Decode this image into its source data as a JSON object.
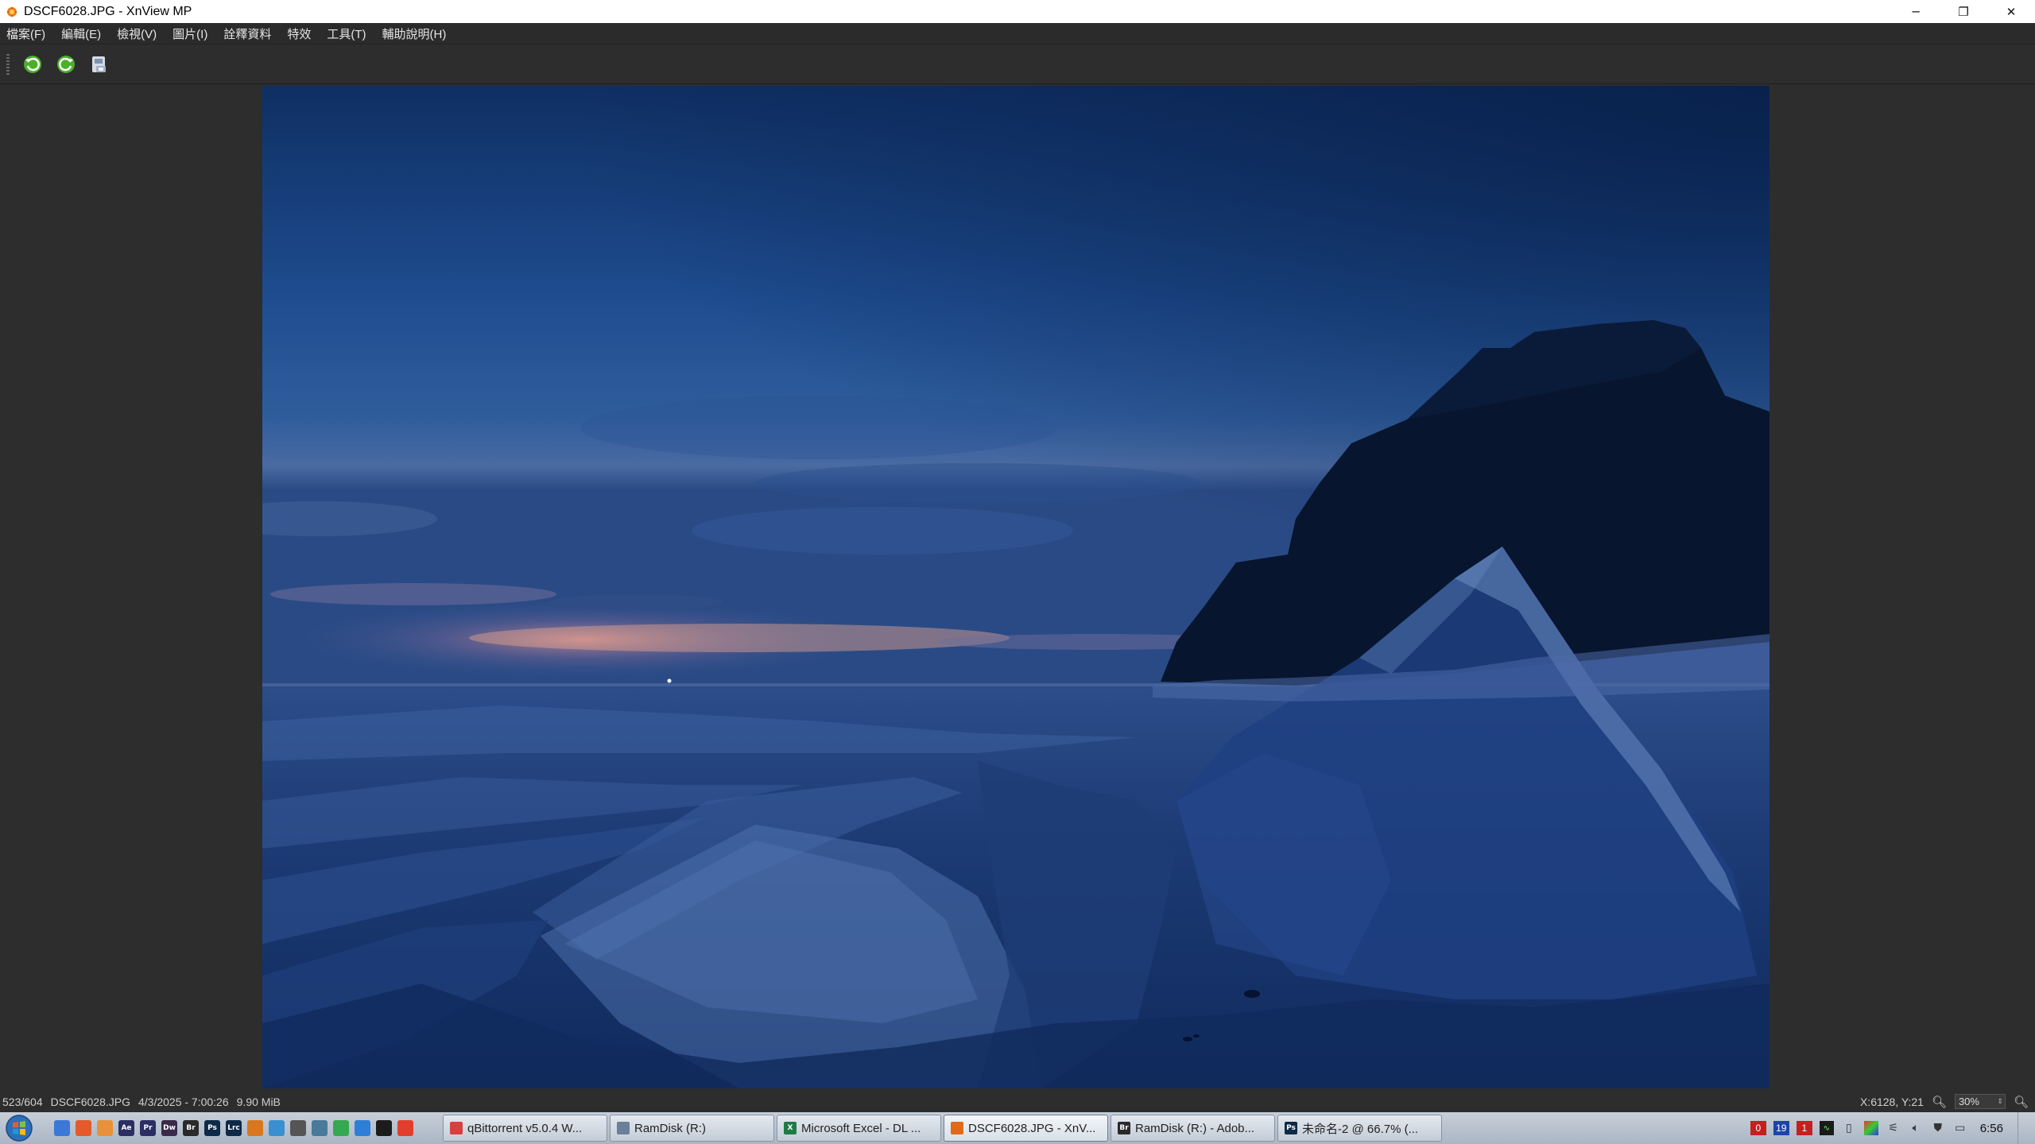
{
  "window": {
    "title": "DSCF6028.JPG - XnView MP",
    "minimize": "─",
    "restore": "❐",
    "close": "✕"
  },
  "menu": {
    "items": [
      "檔案(F)",
      "編輯(E)",
      "檢視(V)",
      "圖片(I)",
      "詮釋資料",
      "特效",
      "工具(T)",
      "輔助說明(H)"
    ]
  },
  "toolbar": {
    "buttons": [
      "rotate-left-icon",
      "rotate-right-icon",
      "save-icon"
    ]
  },
  "viewer": {
    "image": "lake-ice-twilight-photo"
  },
  "status": {
    "index": "523/604",
    "filename": "DSCF6028.JPG",
    "datetime": "4/3/2025 - 7:00:26",
    "filesize": "9.90 MiB",
    "coords": "X:6128, Y:21",
    "zoom": "30%"
  },
  "taskbar": {
    "quick_launch": [
      {
        "label": "",
        "color": "#3b78d8"
      },
      {
        "label": "",
        "color": "#e55a2b"
      },
      {
        "label": "",
        "color": "#e8913a"
      },
      {
        "label": "Ae",
        "color": "#2b2e62"
      },
      {
        "label": "Pr",
        "color": "#2b2e62"
      },
      {
        "label": "Dw",
        "color": "#3c2a4a"
      },
      {
        "label": "Br",
        "color": "#2a2a2a"
      },
      {
        "label": "Ps",
        "color": "#0d2a47"
      },
      {
        "label": "Lrc",
        "color": "#0d2a47"
      },
      {
        "label": "",
        "color": "#d9771e"
      },
      {
        "label": "",
        "color": "#3a8fd0"
      },
      {
        "label": "",
        "color": "#555555"
      },
      {
        "label": "",
        "color": "#4a7a9a"
      },
      {
        "label": "",
        "color": "#35a852"
      },
      {
        "label": "",
        "color": "#2e7fd8"
      },
      {
        "label": "",
        "color": "#1c1c1c"
      },
      {
        "label": "",
        "color": "#e33e2b"
      }
    ],
    "tasks": [
      {
        "label": "qBittorrent v5.0.4 W...",
        "icon_color": "#d84040",
        "icon_text": ""
      },
      {
        "label": "RamDisk (R:)",
        "icon_color": "#6a7f99",
        "icon_text": ""
      },
      {
        "label": "Microsoft Excel - DL ...",
        "icon_color": "#1f7a45",
        "icon_text": "X"
      },
      {
        "label": "DSCF6028.JPG - XnV...",
        "icon_color": "#e06a1a",
        "icon_text": ""
      },
      {
        "label": "RamDisk (R:) - Adob...",
        "icon_color": "#2a2a2a",
        "icon_text": "Br"
      },
      {
        "label": "未命名-2 @ 66.7% (...",
        "icon_color": "#0d2a47",
        "icon_text": "Ps"
      }
    ],
    "active_task": 3,
    "tray_badges": [
      {
        "text": "0",
        "color": "#c32020"
      },
      {
        "text": "19",
        "color": "#1f44a8"
      },
      {
        "text": "1",
        "color": "#c32020"
      }
    ],
    "clock": "6:56"
  }
}
